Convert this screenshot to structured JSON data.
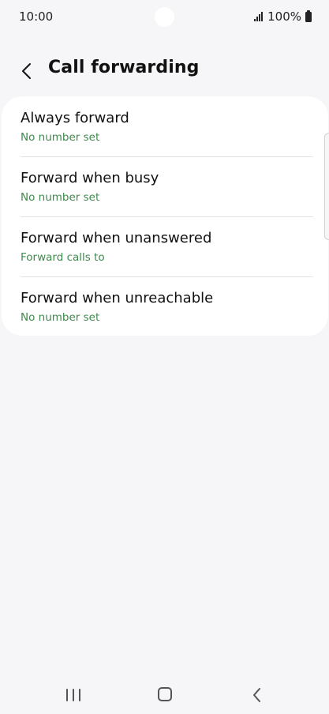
{
  "status_bar": {
    "time": "10:00",
    "battery": "100%"
  },
  "header": {
    "title": "Call forwarding"
  },
  "items": [
    {
      "title": "Always forward",
      "subtitle": "No number set"
    },
    {
      "title": "Forward when busy",
      "subtitle": "No number set"
    },
    {
      "title": "Forward when unanswered",
      "subtitle": "Forward calls to"
    },
    {
      "title": "Forward when unreachable",
      "subtitle": "No number set"
    }
  ],
  "colors": {
    "background": "#f6f6f8",
    "card": "#ffffff",
    "subtitle_accent": "#3e8a4c"
  },
  "icons": {
    "back": "chevron-left-icon",
    "signal": "signal-icon",
    "battery": "battery-icon",
    "nav_recent": "recent-apps-icon",
    "nav_home": "home-icon",
    "nav_back": "nav-back-icon"
  }
}
